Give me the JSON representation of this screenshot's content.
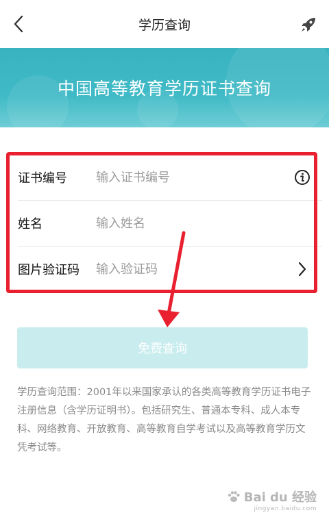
{
  "header": {
    "title": "学历查询",
    "back_icon": "chevron-left-icon",
    "action_icon": "rocket-icon"
  },
  "banner": {
    "title": "中国高等教育学历证书查询",
    "color": "#3cb6c2"
  },
  "form": {
    "rows": [
      {
        "label": "证书编号",
        "placeholder": "输入证书编号",
        "icon": "info-icon"
      },
      {
        "label": "姓名",
        "placeholder": "输入姓名",
        "icon": ""
      },
      {
        "label": "图片验证码",
        "placeholder": "输入验证码",
        "icon": "chevron-right-icon"
      }
    ]
  },
  "submit": {
    "label": "免费查询",
    "color": "#c9ecee"
  },
  "description": "学历查询范围：2001年以来国家承认的各类高等教育学历证书电子注册信息（含学历证明书）。包括研究生、普通本专科、成人本专科、网络教育、开放教育、高等教育自学考试以及高等教育学历文凭考试等。",
  "annotation": {
    "color": "#e8202f"
  },
  "watermark": {
    "text": "Bai du 经验",
    "subtext": "jingyan.baidu.com"
  }
}
